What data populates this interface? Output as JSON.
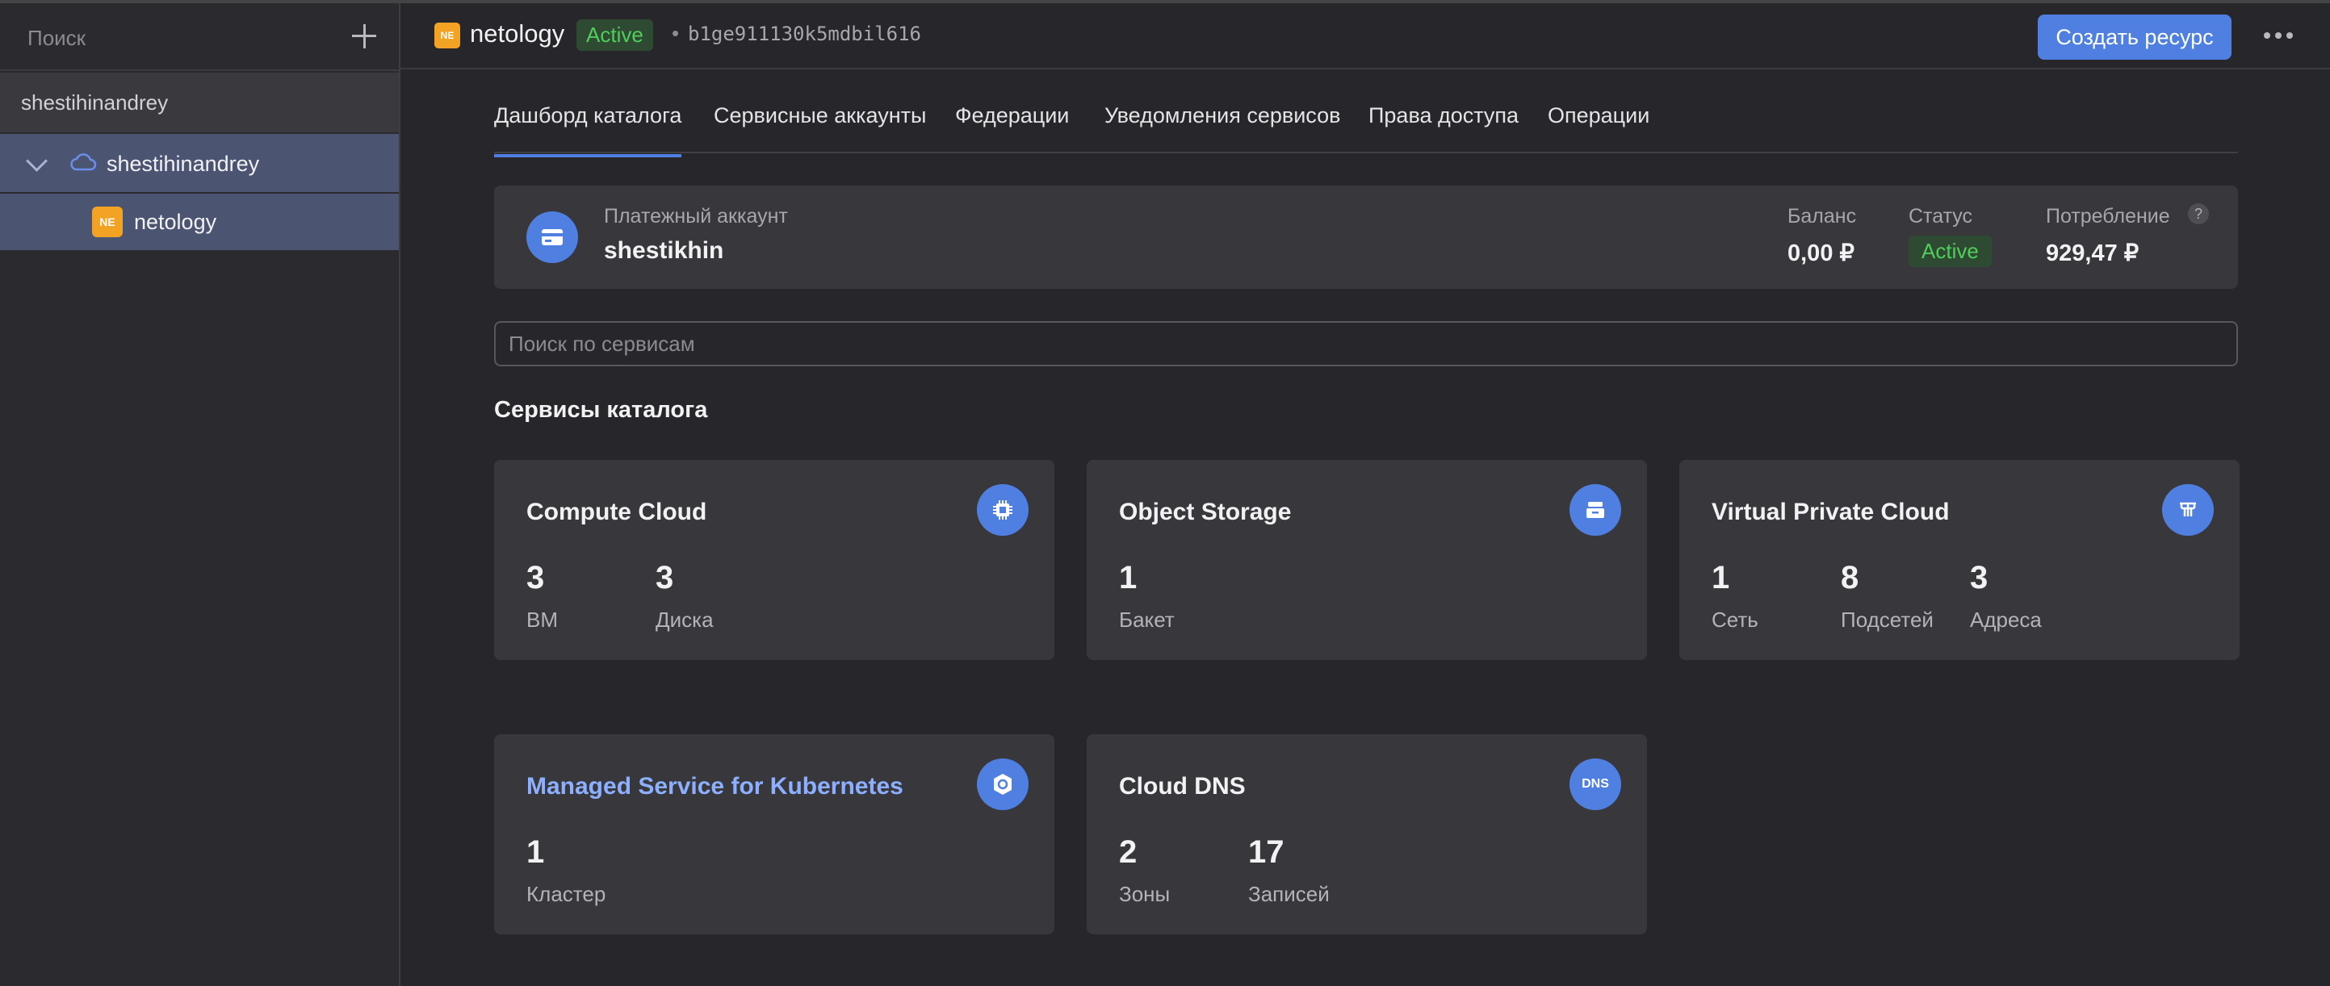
{
  "sidebar": {
    "search_placeholder": "Поиск",
    "org_name": "shestihinandrey",
    "cloud_label": "shestihinandrey",
    "folder_badge": "NE",
    "folder_label": "netology"
  },
  "header": {
    "badge": "NE",
    "title": "netology",
    "status": "Active",
    "separator": "•",
    "folder_id": "b1ge911130k5mdbil616",
    "create_button": "Создать ресурс"
  },
  "tabs": [
    {
      "label": "Дашборд каталога",
      "active": true
    },
    {
      "label": "Сервисные аккаунты",
      "active": false
    },
    {
      "label": "Федерации",
      "active": false
    },
    {
      "label": "Уведомления сервисов",
      "active": false
    },
    {
      "label": "Права доступа",
      "active": false
    },
    {
      "label": "Операции",
      "active": false
    }
  ],
  "billing": {
    "label": "Платежный аккаунт",
    "name": "shestikhin",
    "balance_label": "Баланс",
    "balance": "0,00 ₽",
    "status_label": "Статус",
    "status": "Active",
    "consumption_label": "Потребление",
    "consumption": "929,47 ₽"
  },
  "services": {
    "search_placeholder": "Поиск по сервисам",
    "section_title": "Сервисы каталога",
    "cards": [
      {
        "title": "Compute Cloud",
        "icon": "cpu-icon",
        "metrics": [
          {
            "value": "3",
            "label": "ВМ"
          },
          {
            "value": "3",
            "label": "Диска"
          }
        ]
      },
      {
        "title": "Object Storage",
        "icon": "storage-icon",
        "metrics": [
          {
            "value": "1",
            "label": "Бакет"
          }
        ]
      },
      {
        "title": "Virtual Private Cloud",
        "icon": "network-icon",
        "metrics": [
          {
            "value": "1",
            "label": "Сеть"
          },
          {
            "value": "8",
            "label": "Подсетей"
          },
          {
            "value": "3",
            "label": "Адреса"
          }
        ]
      },
      {
        "title": "Managed Service for Kubernetes",
        "icon": "kubernetes-icon",
        "metrics": [
          {
            "value": "1",
            "label": "Кластер"
          }
        ]
      },
      {
        "title": "Cloud DNS",
        "icon": "dns-icon",
        "icon_text": "DNS",
        "metrics": [
          {
            "value": "2",
            "label": "Зоны"
          },
          {
            "value": "17",
            "label": "Записей"
          }
        ]
      }
    ]
  },
  "colors": {
    "accent": "#4f7fe0",
    "active_status": "#4fce5a",
    "folder_badge": "#f2a324",
    "link": "#8cb0ff"
  }
}
